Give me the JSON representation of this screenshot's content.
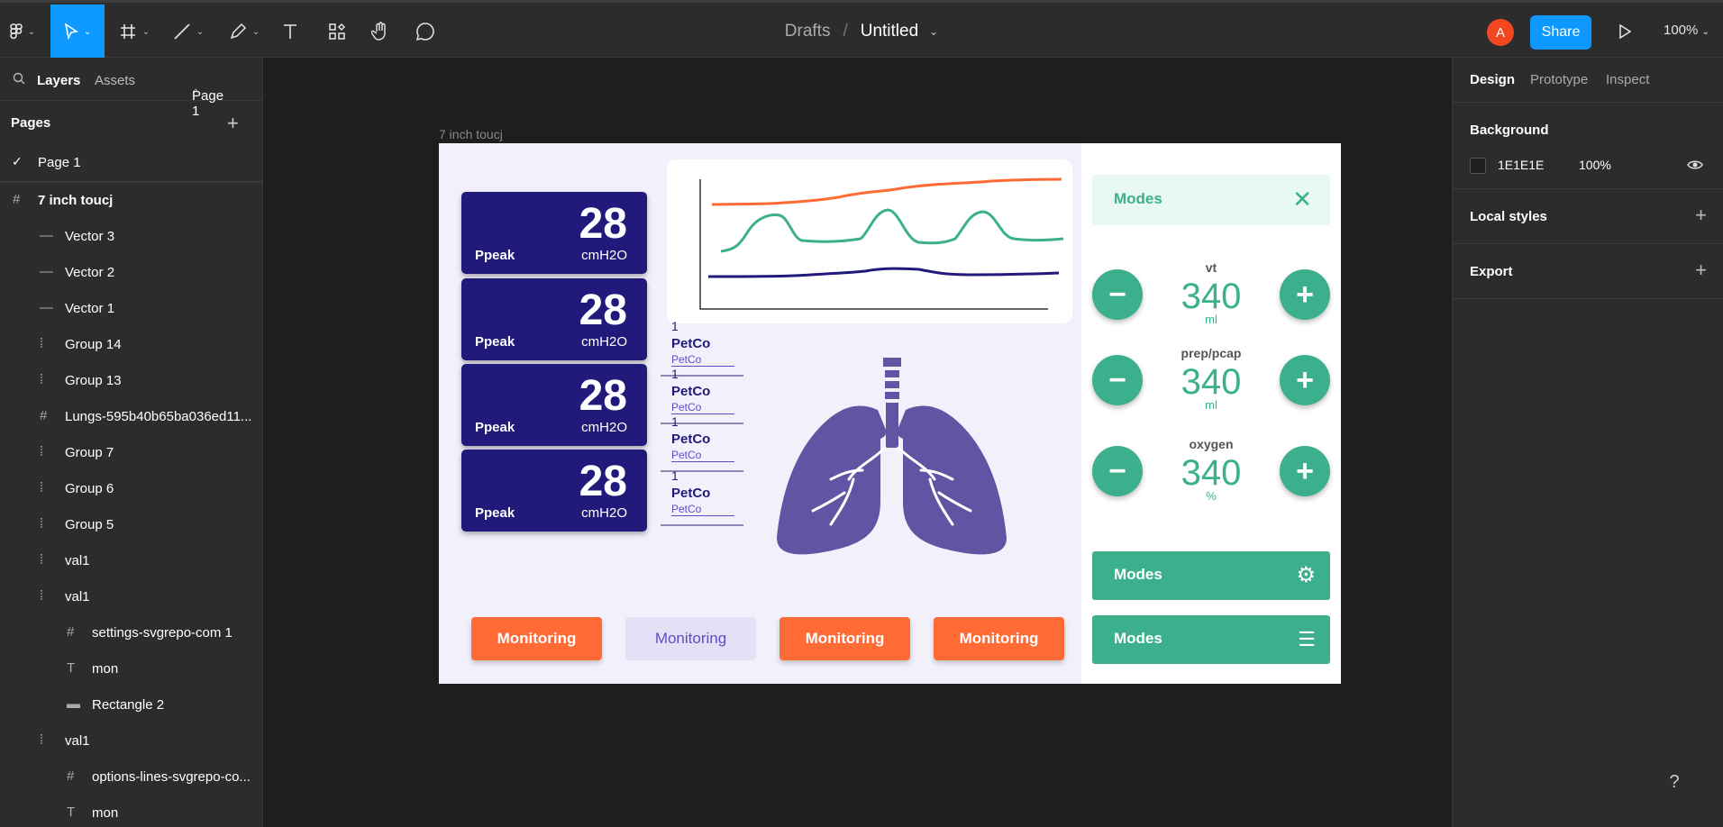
{
  "toolbar": {
    "breadcrumb_root": "Drafts",
    "breadcrumb_sep": "/",
    "file_title": "Untitled",
    "avatar_letter": "A",
    "share_label": "Share",
    "zoom": "100%"
  },
  "left_panel": {
    "tab_layers": "Layers",
    "tab_assets": "Assets",
    "page_select": "Page 1",
    "pages_label": "Pages",
    "page_name": "Page 1",
    "layers": [
      {
        "name": "7 inch toucj",
        "icon": "frame-icon"
      },
      {
        "name": "Vector 3",
        "icon": "line-icon"
      },
      {
        "name": "Vector 2",
        "icon": "line-icon"
      },
      {
        "name": "Vector 1",
        "icon": "line-icon"
      },
      {
        "name": "Group 14",
        "icon": "group-icon"
      },
      {
        "name": "Group 13",
        "icon": "group-icon"
      },
      {
        "name": "Lungs-595b40b65ba036ed11...",
        "icon": "frame-icon"
      },
      {
        "name": "Group 7",
        "icon": "group-icon"
      },
      {
        "name": "Group 6",
        "icon": "group-icon"
      },
      {
        "name": "Group 5",
        "icon": "group-icon"
      },
      {
        "name": "val1",
        "icon": "group-icon"
      },
      {
        "name": "val1",
        "icon": "group-icon"
      },
      {
        "name": "settings-svgrepo-com 1",
        "icon": "frame-icon"
      },
      {
        "name": "mon",
        "icon": "text-icon"
      },
      {
        "name": "Rectangle 2",
        "icon": "rectangle-icon"
      },
      {
        "name": "val1",
        "icon": "group-icon"
      },
      {
        "name": "options-lines-svgrepo-co...",
        "icon": "frame-icon"
      },
      {
        "name": "mon",
        "icon": "text-icon"
      }
    ]
  },
  "canvas": {
    "frame_label": "7 inch toucj",
    "ppeak_cards": [
      {
        "value": "28",
        "label": "Ppeak",
        "unit": "cmH2O"
      },
      {
        "value": "28",
        "label": "Ppeak",
        "unit": "cmH2O"
      },
      {
        "value": "28",
        "label": "Ppeak",
        "unit": "cmH2O"
      },
      {
        "value": "28",
        "label": "Ppeak",
        "unit": "cmH2O"
      }
    ],
    "petco_items": [
      {
        "num": "1",
        "title": "PetCo",
        "sub": "PetCo"
      },
      {
        "num": "1",
        "title": "PetCo",
        "sub": "PetCo"
      },
      {
        "num": "1",
        "title": "PetCo",
        "sub": "PetCo"
      },
      {
        "num": "1",
        "title": "PetCo",
        "sub": "PetCo"
      }
    ],
    "monitoring_buttons": [
      "Monitoring",
      "Monitoring",
      "Monitoring",
      "Monitoring"
    ],
    "modes_header": "Modes",
    "controls": [
      {
        "label": "vt",
        "value": "340",
        "unit": "ml"
      },
      {
        "label": "prep/pcap",
        "value": "340",
        "unit": "ml"
      },
      {
        "label": "oxygen",
        "value": "340",
        "unit": "%"
      }
    ],
    "mode_buttons": [
      "Modes",
      "Modes"
    ],
    "colors": {
      "orange": "#ff6a35",
      "navy": "#211a7a",
      "green": "#3caf8c",
      "lungs": "#5f55a3"
    }
  },
  "right_panel": {
    "tab_design": "Design",
    "tab_prototype": "Prototype",
    "tab_inspect": "Inspect",
    "background_label": "Background",
    "bg_hex": "1E1E1E",
    "bg_opacity": "100%",
    "local_styles": "Local styles",
    "export": "Export"
  },
  "help": "?"
}
